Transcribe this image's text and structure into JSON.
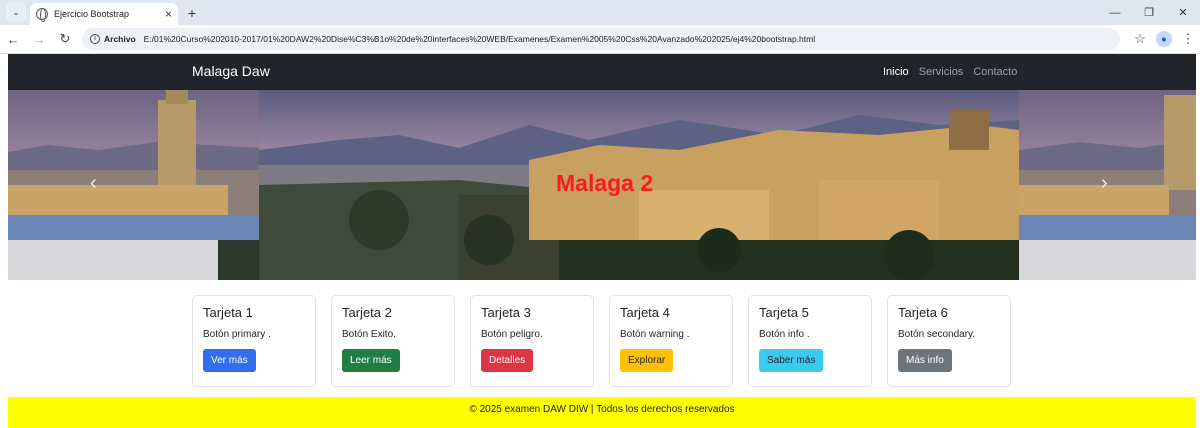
{
  "browser": {
    "tab_title": "Ejercicio Bootstrap",
    "url_scheme": "Archivo",
    "url": "E:/01%20Curso%202010-2017/01%20DAW2%20Dise%C3%B1o%20de%20interfaces%20WEB/Examenes/Examen%2005%20Css%20Avanzado%202025/ej4%20bootstrap.html"
  },
  "navbar": {
    "brand": "Malaga Daw",
    "links": [
      {
        "label": "Inicio",
        "active": true
      },
      {
        "label": "Servicios",
        "active": false
      },
      {
        "label": "Contacto",
        "active": false
      }
    ]
  },
  "carousel": {
    "caption": "Malaga 2",
    "caption_color": "#ff1a1a"
  },
  "cards": [
    {
      "title": "Tarjeta 1",
      "text": "Botón primary .",
      "button": "Ver más",
      "color": "#2f6fee",
      "text_color": "#ffffff"
    },
    {
      "title": "Tarjeta 2",
      "text": "Botón Exito.",
      "button": "Leer más",
      "color": "#1e7e46",
      "text_color": "#ffffff"
    },
    {
      "title": "Tarjeta 3",
      "text": "Botón peligro.",
      "button": "Detalles",
      "color": "#dc3545",
      "text_color": "#ffffff"
    },
    {
      "title": "Tarjeta 4",
      "text": "Botón warning .",
      "button": "Explorar",
      "color": "#ffc107",
      "text_color": "#212529"
    },
    {
      "title": "Tarjeta 5",
      "text": "Botón info .",
      "button": "Saber más",
      "color": "#3dcaf0",
      "text_color": "#212529"
    },
    {
      "title": "Tarjeta 6",
      "text": "Botón secondary.",
      "button": "Más info",
      "color": "#6c757d",
      "text_color": "#ffffff"
    }
  ],
  "footer": {
    "text": "© 2025 examen DAW DIW | Todos los derechos reservados",
    "background": "#ffff00"
  },
  "icons": [
    "globe-icon",
    "close-icon",
    "plus-icon",
    "back-icon",
    "forward-icon",
    "reload-icon",
    "info-icon",
    "star-icon",
    "profile-icon",
    "minimize-icon",
    "maximize-icon",
    "window-close-icon",
    "carousel-prev-icon",
    "carousel-next-icon"
  ]
}
